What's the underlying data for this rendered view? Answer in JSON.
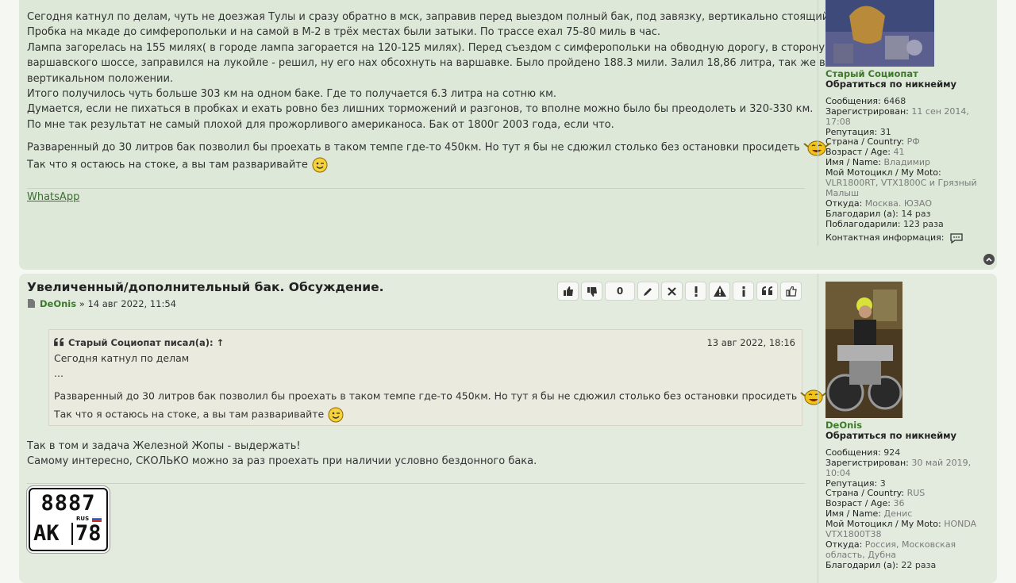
{
  "post1": {
    "lines": [
      "Сегодня катнул по делам, чуть не доезжая Тулы и сразу обратно в мск, заправив перед выездом полный бак, под завязку, вертикально стоящий мот.",
      "Пробка на мкаде до симферопольки и на самой в М-2 в трёх местах были затыки. По трассе ехал 75-80 миль в час.",
      "Лампа загорелась на 155 милях( в городе лампа загорается на 120-125 милях). Перед съездом с симферопольки на обводную дорогу, в сторону",
      "варшавского шоссе, заправился на лукойле - решил, ну его нах обсохнуть на варшавке. Было пройдено 188.3 мили. Залил 18,86 литра, так же в",
      "вертикальном положении.",
      "Итого получилось чуть больше 303 км на одном баке. Где то получается 6.3 литра на сотню км.",
      "Думается, если не пихаться в пробках и ехать ровно без лишних торможений и разгонов, то вполне можно было бы преодолеть и 320-330 км.",
      "По мне так результат не самый плохой для прожорливого американоса. Бак от 1800г 2003 года, если что."
    ],
    "line_smiley1": "Разваренный до 30 литров бак позволил бы проехать в таком темпе где-то 450км. Но тут я бы не сдюжил столько без остановки просидеть",
    "line_smiley2": "Так что я остаюсь на стоке, а вы там разваривайте",
    "signature_link": "WhatsApp",
    "profile": {
      "username": "Старый Социопат",
      "contact_nick": "Обратиться по никнейму",
      "fields": [
        {
          "label": "Сообщения:",
          "value": "6468",
          "dark": true
        },
        {
          "label": "Зарегистрирован:",
          "value": "11 сен 2014, 17:08",
          "dark": false
        },
        {
          "label": "Репутация:",
          "value": "31",
          "dark": true
        },
        {
          "label": "Страна / Country:",
          "value": "РФ",
          "dark": false
        },
        {
          "label": "Возраст / Age:",
          "value": "41",
          "dark": false
        },
        {
          "label": "Имя / Name:",
          "value": "Владимир",
          "dark": false
        },
        {
          "label": "Мой Мотоцикл / My Moto:",
          "value": "VLR1800RT, VTX1800C и Грязный Малыш",
          "dark": false
        },
        {
          "label": "Откуда:",
          "value": "Москва. ЮЗАО",
          "dark": false
        },
        {
          "label": "Благодарил (а):",
          "value": "14 раз",
          "dark": true
        },
        {
          "label": "Поблагодарили:",
          "value": "123 раза",
          "dark": true
        }
      ],
      "contact_info": "Контактная информация:"
    }
  },
  "post2": {
    "title": "Увеличенный/дополнительный бак. Обсуждение.",
    "author": "DeOnis",
    "date": "» 14 авг 2022, 11:54",
    "like_count": "0",
    "quote": {
      "header": "Старый Социопат писал(а): ↑",
      "date": "13 авг 2022, 18:16",
      "line1": "Сегодня катнул по делам",
      "line2": "...",
      "line3": "Разваренный до 30 литров бак позволил бы проехать в таком темпе где-то 450км. Но тут я бы не сдюжил столько без остановки просидеть",
      "line4": "Так что я остаюсь на стоке, а вы там разваривайте"
    },
    "reply": [
      "Так в том и задача Железной Жопы - выдержать!",
      "Самому интересно, СКОЛЬКО можно за раз проехать при наличии условно бездонного бака."
    ],
    "plate": {
      "top": "8887",
      "region_label": "RUS",
      "letters": "АК",
      "region": "78"
    },
    "profile": {
      "username": "DeOnis",
      "contact_nick": "Обратиться по никнейму",
      "fields": [
        {
          "label": "Сообщения:",
          "value": "924",
          "dark": true
        },
        {
          "label": "Зарегистрирован:",
          "value": "30 май 2019, 10:04",
          "dark": false
        },
        {
          "label": "Репутация:",
          "value": "3",
          "dark": true
        },
        {
          "label": "Страна / Country:",
          "value": "RUS",
          "dark": false
        },
        {
          "label": "Возраст / Age:",
          "value": "36",
          "dark": false
        },
        {
          "label": "Имя / Name:",
          "value": "Денис",
          "dark": false
        },
        {
          "label": "Мой Мотоцикл / My Moto:",
          "value": "HONDA VTX1800T38",
          "dark": false
        },
        {
          "label": "Откуда:",
          "value": "Россия, Московская область, Дубна",
          "dark": false
        },
        {
          "label": "Благодарил (а):",
          "value": "22 раза",
          "dark": true
        }
      ]
    }
  }
}
